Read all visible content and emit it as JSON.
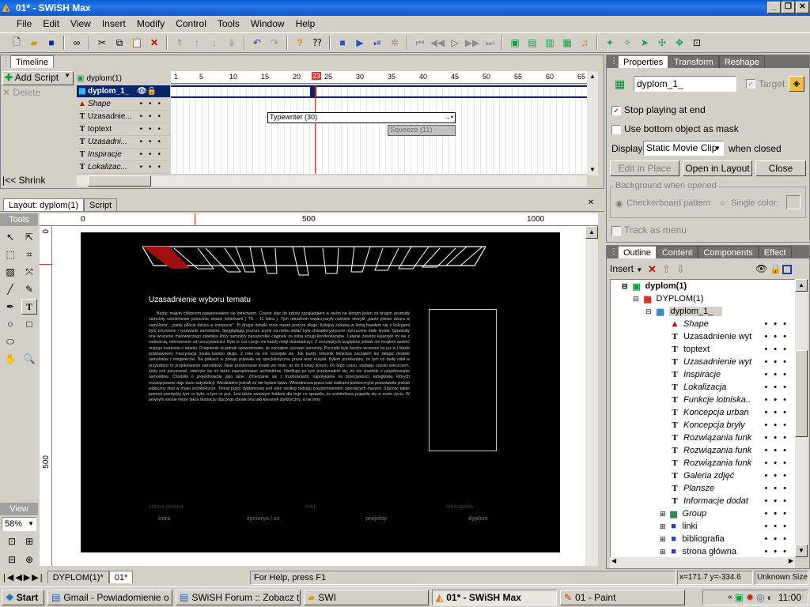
{
  "window": {
    "title": "01* - SWiSH Max"
  },
  "menu": [
    "File",
    "Edit",
    "View",
    "Insert",
    "Modify",
    "Control",
    "Tools",
    "Window",
    "Help"
  ],
  "timeline": {
    "tab": "Timeline",
    "add_script": "Add Script",
    "delete": "Delete",
    "shrink": "Shrink",
    "root": "dyplom(1)",
    "ruler": [
      "1",
      "5",
      "10",
      "15",
      "20",
      "23",
      "25",
      "30",
      "35",
      "40",
      "45",
      "50",
      "55",
      "60",
      "65"
    ],
    "playhead_frame": "23",
    "layers": [
      {
        "icon": "movie-clip-icon",
        "name": "dyplom_1_"
      },
      {
        "icon": "shape-icon",
        "name": "Shape"
      },
      {
        "icon": "text-icon",
        "name": "Uzasadnie..."
      },
      {
        "icon": "text-icon",
        "name": "toptext"
      },
      {
        "icon": "text-icon",
        "name": "Uzasadni..."
      },
      {
        "icon": "text-icon",
        "name": "Inspiracje"
      },
      {
        "icon": "text-icon",
        "name": "Lokalizac..."
      }
    ],
    "effects": [
      "Typewriter (30)",
      "Squeeze (11)"
    ]
  },
  "layout": {
    "tab_layout": "Layout: dyplom(1)",
    "tab_script": "Script",
    "ruler": [
      "0",
      "500",
      "1000"
    ],
    "vruler": [
      "0",
      "500"
    ],
    "tools_label": "Tools",
    "view_label": "View",
    "zoom": "58%"
  },
  "canvas": {
    "heading": "Uzasadnienie wyboru tematu",
    "body": "Będąc małym chłopcem pasjonowałem się lotnictwem. Często idąc do szkoły spoglądałem w niebo na którym jeden za drugim szumiały samoloty szkoleniowe potocznie zwane Iskierkami ( TS – 11 Iskra ). Tym obrazkom towarzyszyły radosne okrzyki „panie pilocie dziura w samolocie”, „panie pilocie dziura w kompocie”. To drugie dziwiło mnie nawet jeszcze długo. Kolejną zabawą w którą bawiłem się z kolegami było zmyślanie i rysowanie samolotów. Spoglądając jeszcze wyżej na niebo widać było charakterystyczne rozrzucone białe kreski. Sprawiały one wrażenie malowniczego zjawiska który samoloty pasażerskie ciągnęły za sobą smugi kondensacyjne. Latanie zawsze kojarzyło mi się z wolnością, oderwaniem od rzeczywistości. Było to coś czego nie każdy mógł doświadczyć. Z oczywistych względów jednak nie mogłem spełnić mojego marzenia o lataniu. Pragnienie to jednak spowodowało, że zacząłem rysować samoloty. Początki były bardzo wczesne bo już w I klasie podstawowej. Fascynacja trwała bardzo długo. Z roku na rok rozwijała się. Jak każdy miłośnik lotnictwa zacząłem też sklejać modele samolotów i śmigłowców. Na półkach w pokoju pojawiła się specjalistyczna prasa oraz książki. Byłem przekonany, że tym co będę robił w przyszłości to projektowanie samolotów. Takie przekonanie trwało we mnie, aż do 3 klasy liceum. Do tego czasu, siadając często wieczorem, żeby coś porysować, zdarzyło się mi także zaprojektować architekturę. Niedługo po tym przekonałem się, że nie chodziło o projektowanie samolotów. Chodziło o projektowanie jako takie. Zmierzanie się z trudnościami, napotykanie na przeciwności, łamigłówki, których rozwiązywanie daje dużo satysfakcji. Wiedziałem jednak że nie będzie łatwo. Wielodniowa praca nad statkami powietrznymi pozostawiła jednak widoczny ślad w mojej architekturze. Temat pracy dyplomowej jest więc według radzaju przypomnieniem dziecięcych marzeń. Stanowi także pomost pomiędzy tym co było, a tym co jest. Jest także swoistym hołdem dla tego co sprawiło, że architektura pojawiła się w moim życiu. W pewnym sensie może także tłumaczy dlaczego obrała ona taki kierunek stylistyczny, a nie inny.",
    "nav_top": [
      "strona główna",
      "linki",
      "bibliografia"
    ],
    "nav_bottom": [
      "intro",
      "życiorys / cv",
      "projekty",
      "dyplom"
    ]
  },
  "properties": {
    "tabs": [
      "Properties",
      "Transform",
      "Reshape"
    ],
    "name": "dyplom_1_",
    "target": "Target",
    "stop_playing": "Stop playing at end",
    "use_mask": "Use bottom object as mask",
    "display_label": "Display",
    "display_value": "Static Movie Clip",
    "when_closed": "when closed",
    "edit_in_place": "Edit in Place",
    "open_in_layout": "Open in Layout",
    "close": "Close",
    "bg_group": "Background when opened",
    "checkerboard": "Checkerboard pattern",
    "single_color": "Single color:",
    "track_as_menu": "Track as menu"
  },
  "outline": {
    "tabs": [
      "Outline",
      "Content",
      "Components",
      "Effect"
    ],
    "insert": "Insert",
    "items": [
      {
        "level": 0,
        "icon": "scene-icon",
        "label": "dyplom(1)",
        "bold": true
      },
      {
        "level": 1,
        "icon": "sprite-icon",
        "label": "DYPLOM(1)"
      },
      {
        "level": 2,
        "icon": "movie-clip-icon",
        "label": "dyplom_1_",
        "selected": true
      },
      {
        "level": 3,
        "icon": "shape-icon",
        "label": "Shape",
        "italic": true
      },
      {
        "level": 3,
        "icon": "text-icon",
        "label": "Uzasadnienie wyt"
      },
      {
        "level": 3,
        "icon": "text-icon",
        "label": "toptext"
      },
      {
        "level": 3,
        "icon": "text-icon",
        "label": "Uzasadnienie wyt",
        "italic": true
      },
      {
        "level": 3,
        "icon": "text-icon",
        "label": "Inspiracje",
        "italic": true
      },
      {
        "level": 3,
        "icon": "text-icon",
        "label": "Lokalizacja",
        "italic": true
      },
      {
        "level": 3,
        "icon": "text-icon",
        "label": "Funkcje lotniska..",
        "italic": true
      },
      {
        "level": 3,
        "icon": "text-icon",
        "label": "Koncepcja urban",
        "italic": true
      },
      {
        "level": 3,
        "icon": "text-icon",
        "label": "Koncepcja bryły",
        "italic": true
      },
      {
        "level": 3,
        "icon": "text-icon",
        "label": "Rozwiązania funk",
        "italic": true
      },
      {
        "level": 3,
        "icon": "text-icon",
        "label": "Rozwiązania funk",
        "italic": true
      },
      {
        "level": 3,
        "icon": "text-icon",
        "label": "Rozwiązania funk",
        "italic": true
      },
      {
        "level": 3,
        "icon": "text-icon",
        "label": "Galeria zdjęć",
        "italic": true
      },
      {
        "level": 3,
        "icon": "text-icon",
        "label": "Plansze",
        "italic": true
      },
      {
        "level": 3,
        "icon": "text-icon",
        "label": "Informacje dodat",
        "italic": true
      },
      {
        "level": 3,
        "icon": "group-icon",
        "label": "Group",
        "italic": true,
        "expand": true
      },
      {
        "level": 3,
        "icon": "button-icon",
        "label": "linki",
        "expand": true
      },
      {
        "level": 3,
        "icon": "button-icon",
        "label": "bibliografia",
        "expand": true
      },
      {
        "level": 3,
        "icon": "button-icon",
        "label": "strona główna",
        "expand": true
      }
    ]
  },
  "status": {
    "scene_tabs": [
      "DYPLOM(1)*",
      "01*"
    ],
    "help": "For Help, press F1",
    "coords": "x=171.7 y=-334.6",
    "size": "Unknown Size"
  },
  "taskbar": {
    "start": "Start",
    "tasks": [
      "Gmail - Powiadomienie o ...",
      "SWiSH Forum :: Zobacz t...",
      "SWI",
      "01* - SWiSH Max",
      "01 - Paint"
    ],
    "clock": "11:00"
  },
  "colors": {
    "accent": "#0a246a",
    "titlebar": "#0a5fd6",
    "canvas": "#000000",
    "canvas_text": "#c8c8c8",
    "playhead": "#e03030"
  }
}
